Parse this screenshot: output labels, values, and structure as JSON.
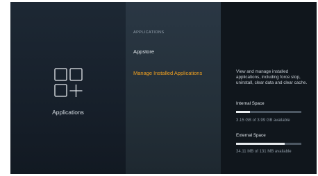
{
  "left_pane": {
    "icon": "apps-grid-plus-icon",
    "label": "Applications"
  },
  "menu": {
    "header": "APPLICATIONS",
    "items": [
      {
        "label": "Appstore",
        "selected": false
      },
      {
        "label": "Manage Installed Applications",
        "selected": true
      }
    ]
  },
  "info": {
    "description": "View and manage installed applications, including force stop, uninstall, clear data and clear cache.",
    "internal": {
      "label": "Internal Space",
      "used_fraction": 0.21,
      "value": "3.15 GB of 3.99 GB available"
    },
    "external": {
      "label": "External Space",
      "used_fraction": 0.74,
      "value": "34.11 MB of 131 MB available"
    }
  },
  "colors": {
    "accent": "#f0a020",
    "bar_track": "#4d5863",
    "bar_fill": "#e8ecef"
  }
}
